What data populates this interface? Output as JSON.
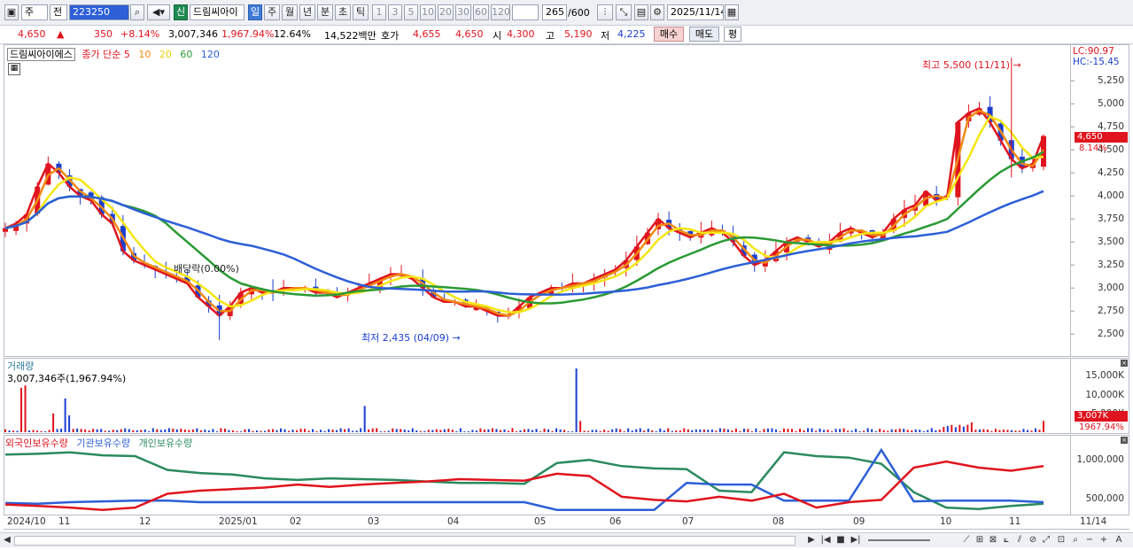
{
  "toolbar": {
    "market": "주",
    "all": "전",
    "code": "223250",
    "new_badge": "신",
    "stock_name_short": "드림씨아이",
    "periods": [
      "일",
      "주",
      "월",
      "년",
      "분",
      "초",
      "틱"
    ],
    "active_period": "일",
    "counts": [
      "1",
      "3",
      "5",
      "10",
      "20",
      "30",
      "60",
      "120"
    ],
    "bar_count": "265",
    "bar_total": "/600",
    "date": "2025/11/14"
  },
  "quote": {
    "price": "4,650",
    "change_arrow": "▲",
    "change": "350",
    "change_pct": "+8.14%",
    "volume": "3,007,346",
    "volume_ratio": "1,967.94%",
    "turnover": "12.64%",
    "amount": "14,522백만",
    "ask_label": "호가",
    "ask": "4,655",
    "bid": "4,650",
    "open_label": "시",
    "open": "4,300",
    "high_label": "고",
    "high": "5,190",
    "low_label": "저",
    "low": "4,225",
    "buy": "매수",
    "sell": "매도",
    "avg": "평"
  },
  "price_panel": {
    "stock_name": "드림씨아이에스",
    "ma_label": "종가 단순",
    "ma_periods": [
      "5",
      "10",
      "20",
      "60",
      "120"
    ],
    "ma_colors": [
      "#e0141e",
      "#f08a12",
      "#f5e614",
      "#2a9a34",
      "#2d5fd6"
    ],
    "lc": "LC:90.97",
    "hc": "HC:-15.45",
    "price_tag": "4,650",
    "pct_tag": "8.14%",
    "high_annotation": "최고 5,500 (11/11)",
    "low_annotation": "최저 2,435 (04/09)",
    "dividend_annotation": "배당락(0.00%)",
    "y_ticks": [
      "5,250",
      "5,000",
      "4,750",
      "4,500",
      "4,250",
      "4,000",
      "3,750",
      "3,500",
      "3,250",
      "3,000",
      "2,750",
      "2,500"
    ]
  },
  "volume_panel": {
    "title": "거래량",
    "value": "3,007,346주(1,967.94%)",
    "y_ticks": [
      "15,000K",
      "10,000K",
      "5,000K"
    ],
    "tag_value": "3,007K",
    "tag_pct": "1967.94%"
  },
  "holding_panel": {
    "series": [
      "외국인보유수량",
      "기관보유수량",
      "개인보유수량"
    ],
    "colors": [
      "#e0141e",
      "#2d5fd6",
      "#2a8a5e"
    ],
    "y_ticks": [
      "1,000,000",
      "500,000"
    ]
  },
  "x_axis": {
    "ticks": [
      "2024/10",
      "11",
      "12",
      "2025/01",
      "02",
      "03",
      "04",
      "05",
      "06",
      "07",
      "08",
      "09",
      "10",
      "11"
    ],
    "last_date": "11/14"
  },
  "chart_data": {
    "type": "line",
    "title": "",
    "ylim": [
      2300,
      5550
    ],
    "months": [
      "2024/10",
      "11",
      "12",
      "2025/01",
      "02",
      "03",
      "04",
      "05",
      "06",
      "07",
      "08",
      "09",
      "10",
      "11"
    ],
    "close": [
      3650,
      3700,
      3800,
      4100,
      4350,
      4250,
      4100,
      4000,
      3950,
      3800,
      3700,
      3400,
      3300,
      3250,
      3200,
      3150,
      3100,
      3050,
      2900,
      2800,
      2700,
      2800,
      2950,
      3000,
      2950,
      2950,
      3000,
      3000,
      3000,
      2950,
      2950,
      2900,
      2950,
      3000,
      3050,
      3100,
      3150,
      3150,
      3100,
      3000,
      2900,
      2850,
      2850,
      2800,
      2800,
      2750,
      2700,
      2700,
      2800,
      2900,
      2950,
      3000,
      3000,
      3050,
      3050,
      3100,
      3150,
      3200,
      3300,
      3450,
      3600,
      3750,
      3650,
      3600,
      3550,
      3600,
      3650,
      3600,
      3500,
      3350,
      3250,
      3300,
      3400,
      3500,
      3550,
      3500,
      3450,
      3500,
      3600,
      3650,
      3600,
      3550,
      3600,
      3750,
      3850,
      3900,
      4050,
      3950,
      4000,
      4800,
      4900,
      4950,
      4800,
      4600,
      4400,
      4300,
      4350,
      4650
    ],
    "ma_series": [
      {
        "name": "5",
        "color": "#e0141e"
      },
      {
        "name": "10",
        "color": "#f08a12"
      },
      {
        "name": "20",
        "color": "#f5e614"
      },
      {
        "name": "60",
        "color": "#2a9a34"
      },
      {
        "name": "120",
        "color": "#2d5fd6"
      }
    ],
    "high": {
      "value": 5500,
      "date": "11/11"
    },
    "low": {
      "value": 2435,
      "date": "04/09"
    },
    "volume_ylim": [
      0,
      17000000
    ],
    "volume_spikes": [
      {
        "month": "06",
        "value": 17000000
      },
      {
        "month": "2024/10",
        "value": 12000000
      }
    ],
    "holding_ylim": [
      300000,
      1200000
    ]
  }
}
